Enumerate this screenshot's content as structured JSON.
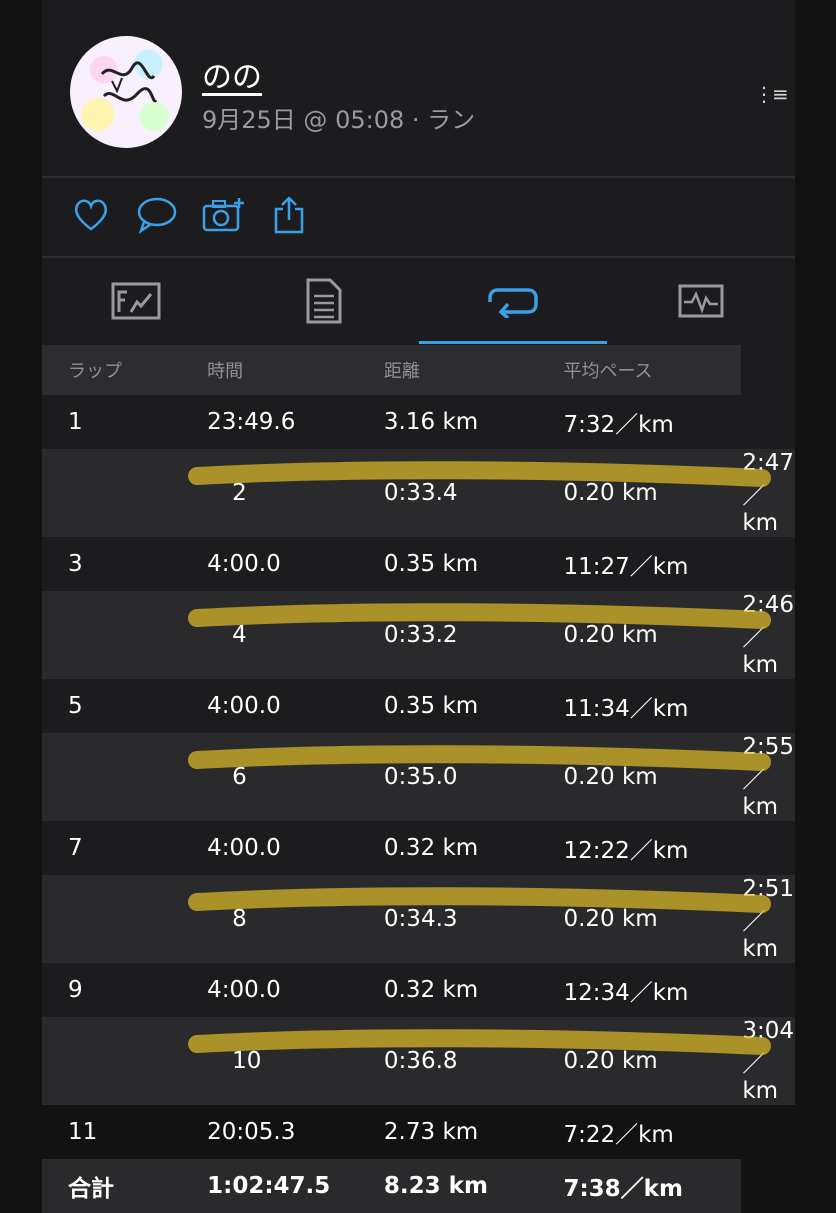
{
  "post": {
    "username": "のの",
    "meta": "9月25日 @ 05:08 · ラン"
  },
  "colors": {
    "accent": "#3aa0e8",
    "highlighter": "#d6b427",
    "background": "#1c1c1e"
  },
  "icons": {
    "actions": [
      "heart-icon",
      "comment-icon",
      "add-photo-icon",
      "share-icon"
    ],
    "tabs": [
      "overview-icon",
      "details-icon",
      "laps-icon",
      "chart-icon"
    ]
  },
  "laps_table": {
    "headers": [
      "ラップ",
      "時間",
      "距離",
      "平均ペース"
    ],
    "rows": [
      [
        "1",
        "23:49.6",
        "3.16 km",
        "7:32／km"
      ],
      [
        "2",
        "0:33.4",
        "0.20 km",
        "2:47／km"
      ],
      [
        "3",
        "4:00.0",
        "0.35 km",
        "11:27／km"
      ],
      [
        "4",
        "0:33.2",
        "0.20 km",
        "2:46／km"
      ],
      [
        "5",
        "4:00.0",
        "0.35 km",
        "11:34／km"
      ],
      [
        "6",
        "0:35.0",
        "0.20 km",
        "2:55／km"
      ],
      [
        "7",
        "4:00.0",
        "0.32 km",
        "12:22／km"
      ],
      [
        "8",
        "0:34.3",
        "0.20 km",
        "2:51／km"
      ],
      [
        "9",
        "4:00.0",
        "0.32 km",
        "12:34／km"
      ],
      [
        "10",
        "0:36.8",
        "0.20 km",
        "3:04／km"
      ],
      [
        "11",
        "20:05.3",
        "2.73 km",
        "7:22／km"
      ]
    ],
    "highlighted_rows": [
      2,
      4,
      6,
      8,
      10
    ],
    "total": [
      "合計",
      "1:02:47.5",
      "8.23 km",
      "7:38／km"
    ]
  }
}
